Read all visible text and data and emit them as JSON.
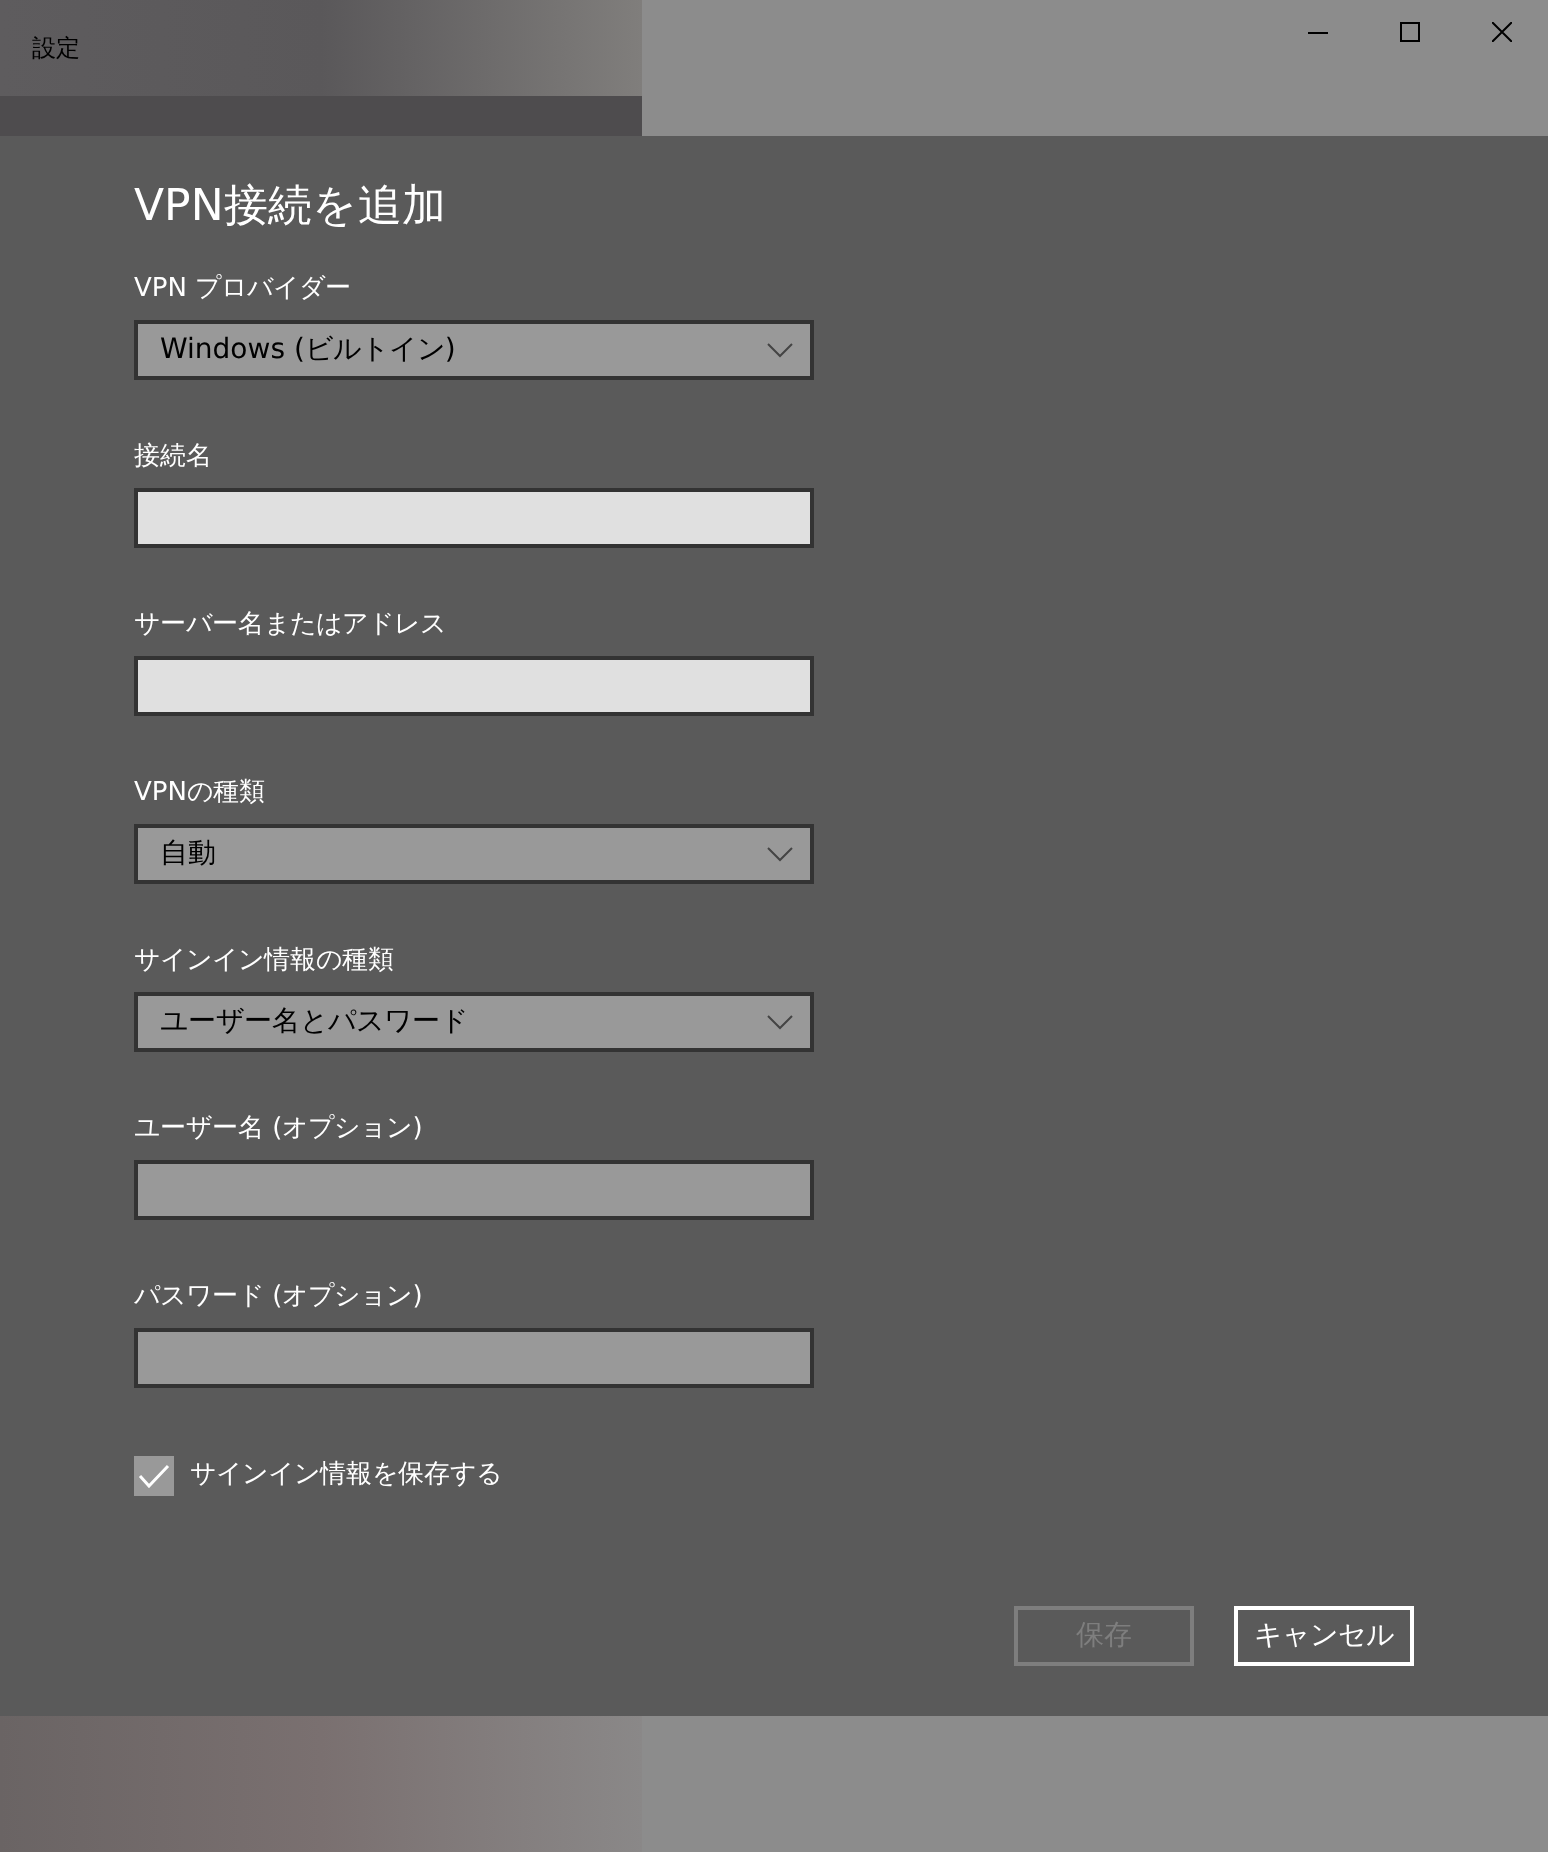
{
  "window": {
    "title": "設定"
  },
  "dialog": {
    "title": "VPN接続を追加",
    "fields": [
      {
        "kind": "dropdown",
        "label": "VPN プロバイダー",
        "value": "Windows (ビルトイン)"
      },
      {
        "kind": "text",
        "label": "接続名",
        "disabled": false
      },
      {
        "kind": "text",
        "label": "サーバー名またはアドレス",
        "disabled": false
      },
      {
        "kind": "dropdown",
        "label": "VPNの種類",
        "value": "自動"
      },
      {
        "kind": "dropdown",
        "label": "サインイン情報の種類",
        "value": "ユーザー名とパスワード"
      },
      {
        "kind": "text",
        "label": "ユーザー名 (オプション)",
        "disabled": true
      },
      {
        "kind": "text",
        "label": "パスワード (オプション)",
        "disabled": true
      }
    ],
    "checkbox": {
      "label": "サインイン情報を保存する",
      "checked": true
    },
    "buttons": [
      {
        "label": "保存",
        "disabled": true
      },
      {
        "label": "キャンセル",
        "disabled": false
      }
    ]
  }
}
